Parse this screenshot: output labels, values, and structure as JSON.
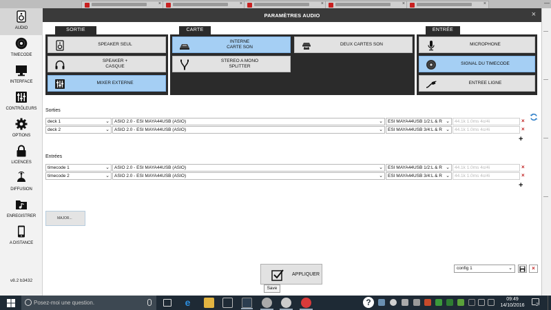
{
  "dialog": {
    "title": "PARAMÈTRES AUDIO",
    "close": "×"
  },
  "sidebar": {
    "items": [
      {
        "label": "AUDIO",
        "icon": "speaker-icon",
        "active": true
      },
      {
        "label": "TIMECODE",
        "icon": "vinyl-icon"
      },
      {
        "label": "INTERFACE",
        "icon": "monitor-icon"
      },
      {
        "label": "CONTRÔLEURS",
        "icon": "mixer-icon"
      },
      {
        "label": "OPTIONS",
        "icon": "gear-icon"
      },
      {
        "label": "LICENCES",
        "icon": "lock-icon"
      },
      {
        "label": "DIFFUSION",
        "icon": "broadcast-icon"
      },
      {
        "label": "ENREGISTRER",
        "icon": "music-folder-icon"
      },
      {
        "label": "A DISTANCE",
        "icon": "phone-icon"
      }
    ],
    "version": "v8.2 b3432"
  },
  "groups": {
    "sortie": {
      "title": "SORTIE",
      "options": [
        {
          "label": "SPEAKER SEUL",
          "selected": false
        },
        {
          "label": "SPEAKER +\nCASQUE",
          "selected": false
        },
        {
          "label": "MIXER EXTERNE",
          "selected": true
        }
      ]
    },
    "carte": {
      "title": "CARTE",
      "options": [
        {
          "label": "INTERNE\nCARTE SON",
          "selected": true
        },
        {
          "label": "DEUX CARTES SON",
          "selected": false
        },
        {
          "label": "STEREO A MONO\nSPLITTER",
          "selected": false
        }
      ]
    },
    "entree": {
      "title": "ENTRÉE",
      "options": [
        {
          "label": "MICROPHONE",
          "selected": false
        },
        {
          "label": "SIGNAL DU TIMECODE",
          "selected": true
        },
        {
          "label": "ENTREE LIGNE",
          "selected": false
        }
      ]
    }
  },
  "outputs": {
    "label": "Sorties",
    "rows": [
      {
        "channel": "deck 1",
        "driver": "ASIO 2.0 - ESI MAYA44USB (ASIO)",
        "port": "ESI MAYA44USB 1/2:L & R",
        "latency": "44.1k 1.0ms 4o/4i"
      },
      {
        "channel": "deck 2",
        "driver": "ASIO 2.0 - ESI MAYA44USB (ASIO)",
        "port": "ESI MAYA44USB 3/4:L & R",
        "latency": "44.1k 1.0ms 4o/4i"
      }
    ]
  },
  "inputs": {
    "label": "Entrées",
    "rows": [
      {
        "channel": "timecode 1",
        "driver": "ASIO 2.0 - ESI MAYA44USB (ASIO)",
        "port": "ESI MAYA44USB 1/2:L & R",
        "latency": "44.1k 1.0ms 4o/4i"
      },
      {
        "channel": "timecode 2",
        "driver": "ASIO 2.0 - ESI MAYA44USB (ASIO)",
        "port": "ESI MAYA44USB 3/4:L & R",
        "latency": "44.1k 1.0ms 4o/4i"
      }
    ]
  },
  "small_button": "MAJOR...",
  "apply": "APPLIQUER",
  "save_tooltip": "Save",
  "config": {
    "value": "config 1"
  },
  "taskbar": {
    "search_placeholder": "Posez-moi une question.",
    "time": "09:49",
    "date": "14/10/2016",
    "notifications": "2",
    "help": "?"
  },
  "colors": {
    "selected": "#a5cff4",
    "dark_panel": "#2b2b2b",
    "title_bar": "#3a3a3a",
    "taskbar": "#1e2a35",
    "delete": "#c02020"
  }
}
